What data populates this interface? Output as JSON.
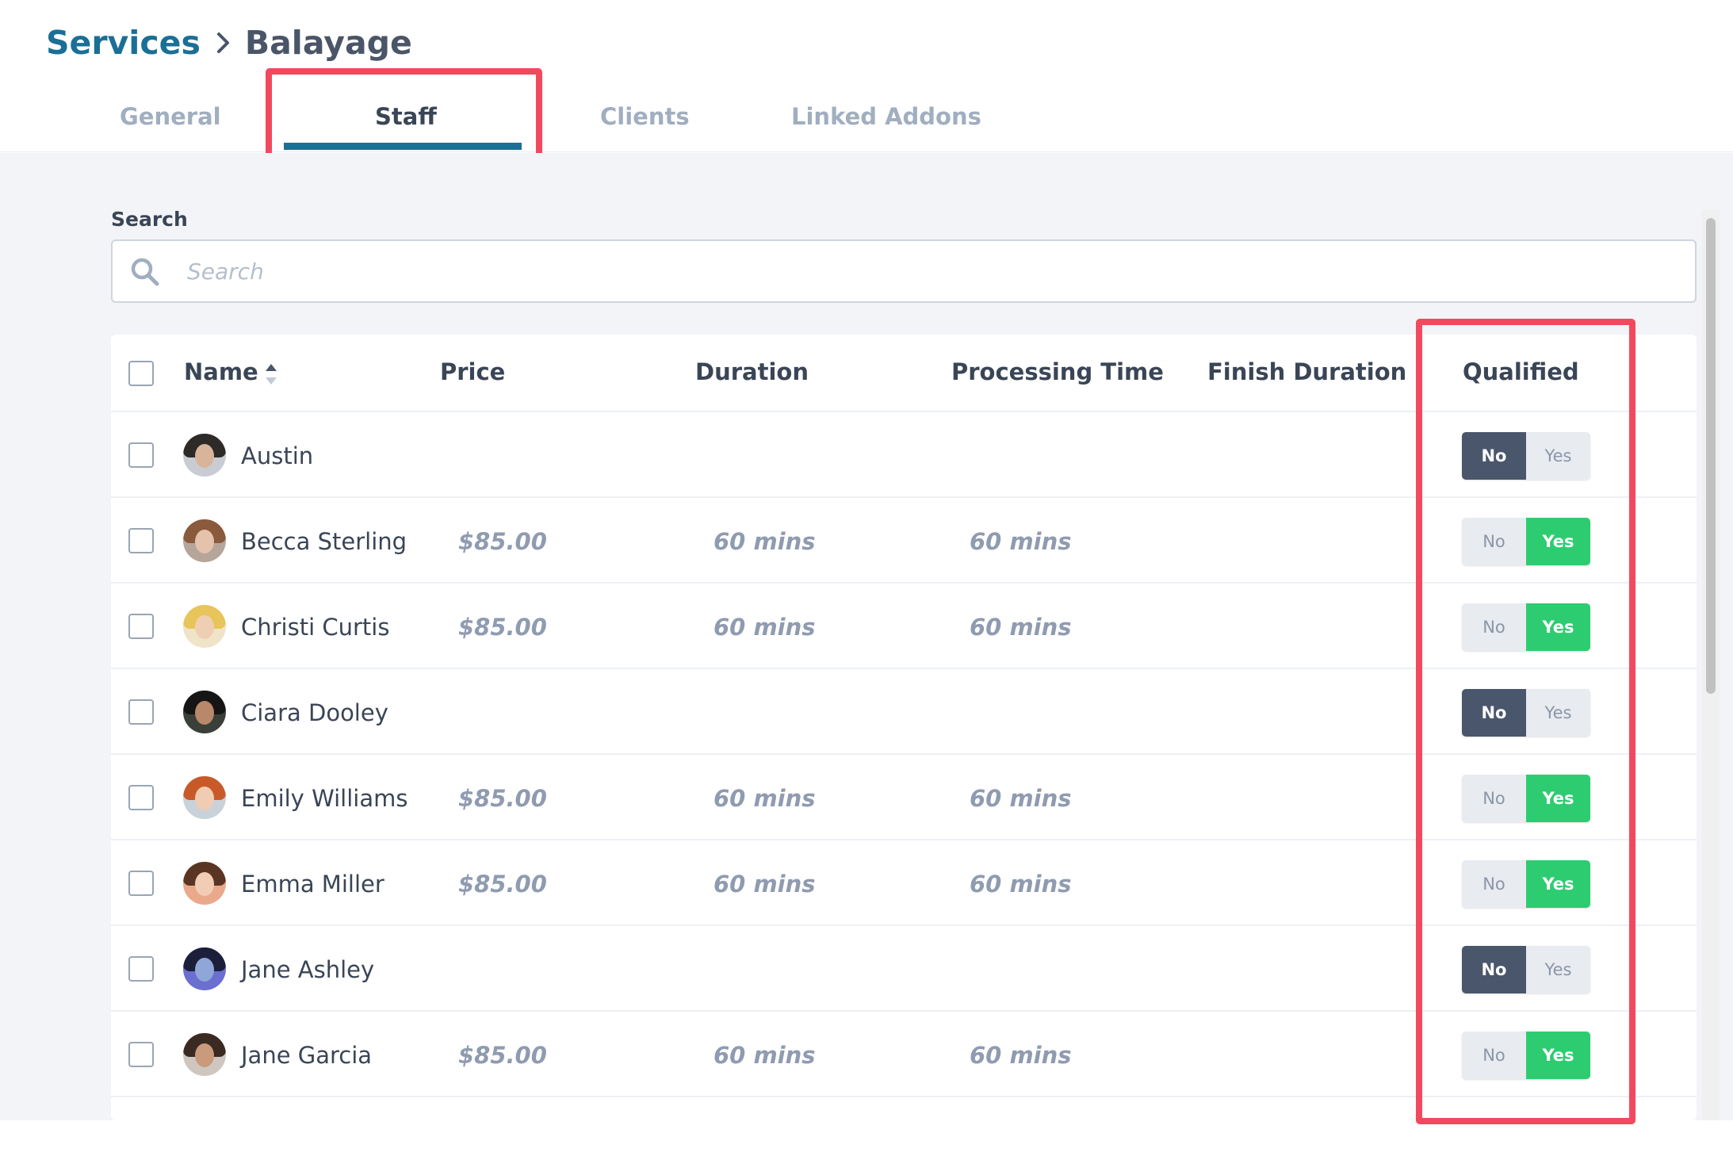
{
  "breadcrumb": {
    "parent": "Services",
    "current": "Balayage"
  },
  "tabs": [
    "General",
    "Staff",
    "Clients",
    "Linked Addons"
  ],
  "active_tab": "Staff",
  "search": {
    "label": "Search",
    "placeholder": "Search",
    "value": ""
  },
  "table": {
    "headers": {
      "name": "Name",
      "price": "Price",
      "duration": "Duration",
      "processing_time": "Processing Time",
      "finish_duration": "Finish Duration",
      "qualified": "Qualified"
    },
    "toggle_labels": {
      "no": "No",
      "yes": "Yes"
    },
    "rows": [
      {
        "name": "Austin",
        "price": "",
        "duration": "",
        "processing_time": "",
        "finish_duration": "",
        "qualified": false
      },
      {
        "name": "Becca Sterling",
        "price": "$85.00",
        "duration": "60 mins",
        "processing_time": "60 mins",
        "finish_duration": "",
        "qualified": true
      },
      {
        "name": "Christi Curtis",
        "price": "$85.00",
        "duration": "60 mins",
        "processing_time": "60 mins",
        "finish_duration": "",
        "qualified": true
      },
      {
        "name": "Ciara Dooley",
        "price": "",
        "duration": "",
        "processing_time": "",
        "finish_duration": "",
        "qualified": false
      },
      {
        "name": "Emily Williams",
        "price": "$85.00",
        "duration": "60 mins",
        "processing_time": "60 mins",
        "finish_duration": "",
        "qualified": true
      },
      {
        "name": "Emma Miller",
        "price": "$85.00",
        "duration": "60 mins",
        "processing_time": "60 mins",
        "finish_duration": "",
        "qualified": true
      },
      {
        "name": "Jane Ashley",
        "price": "",
        "duration": "",
        "processing_time": "",
        "finish_duration": "",
        "qualified": false
      },
      {
        "name": "Jane Garcia",
        "price": "$85.00",
        "duration": "60 mins",
        "processing_time": "60 mins",
        "finish_duration": "",
        "qualified": true
      }
    ]
  },
  "colors": {
    "brand": "#1b6f96",
    "annotation": "#f2495e",
    "toggle_no_active": "#4a566c",
    "toggle_yes_active": "#2ecc71"
  },
  "icons": {
    "breadcrumb_separator": "chevron-right-icon",
    "search": "search-icon",
    "sort": "sort-icon"
  }
}
